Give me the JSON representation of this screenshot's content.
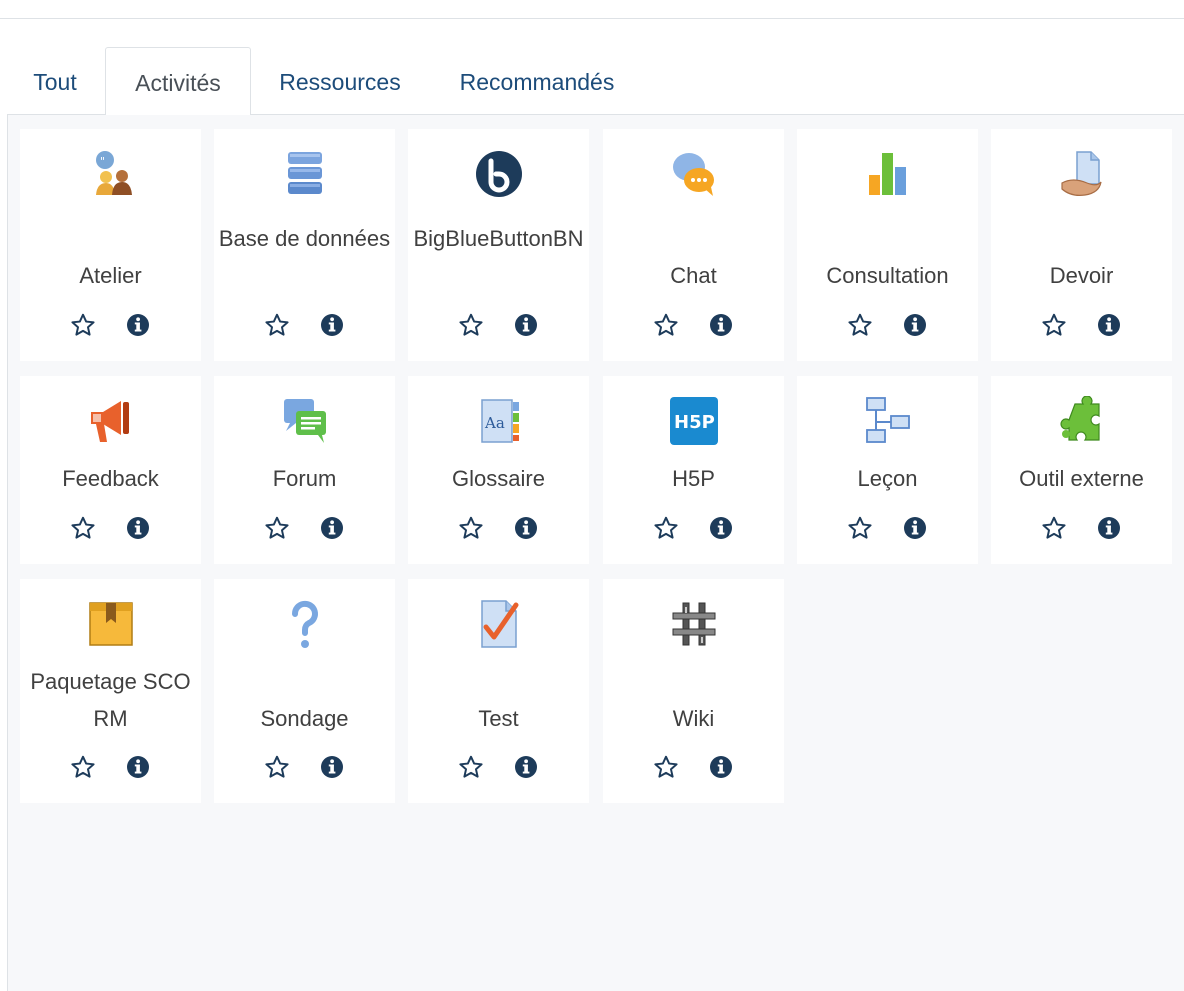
{
  "tabs": [
    {
      "label": "Tout"
    },
    {
      "label": "Activités"
    },
    {
      "label": "Ressources"
    },
    {
      "label": "Recommandés"
    }
  ],
  "active_tab": "Activités",
  "modules": [
    {
      "name": "Atelier",
      "icon": "workshop-icon"
    },
    {
      "name": "Base de données",
      "icon": "database-icon"
    },
    {
      "name": "BigBlueButtonBN",
      "icon": "bigbluebutton-icon"
    },
    {
      "name": "Chat",
      "icon": "chat-icon"
    },
    {
      "name": "Consultation",
      "icon": "choice-chart-icon"
    },
    {
      "name": "Devoir",
      "icon": "assignment-icon"
    },
    {
      "name": "Feedback",
      "icon": "megaphone-icon"
    },
    {
      "name": "Forum",
      "icon": "forum-icon"
    },
    {
      "name": "Glossaire",
      "icon": "glossary-icon"
    },
    {
      "name": "H5P",
      "icon": "h5p-icon"
    },
    {
      "name": "Leçon",
      "icon": "lesson-icon"
    },
    {
      "name": "Outil externe",
      "icon": "puzzle-icon"
    },
    {
      "name": "Paquetage SCORM",
      "icon": "scorm-package-icon"
    },
    {
      "name": "Sondage",
      "icon": "survey-question-icon"
    },
    {
      "name": "Test",
      "icon": "quiz-icon"
    },
    {
      "name": "Wiki",
      "icon": "wiki-icon"
    }
  ],
  "card_actions": {
    "star_icon": "star-outline-icon",
    "info_icon": "info-icon"
  },
  "colors": {
    "link": "#1d4c7a",
    "panel_bg": "#f7f8fa",
    "icon_dark": "#1d3b5a"
  }
}
